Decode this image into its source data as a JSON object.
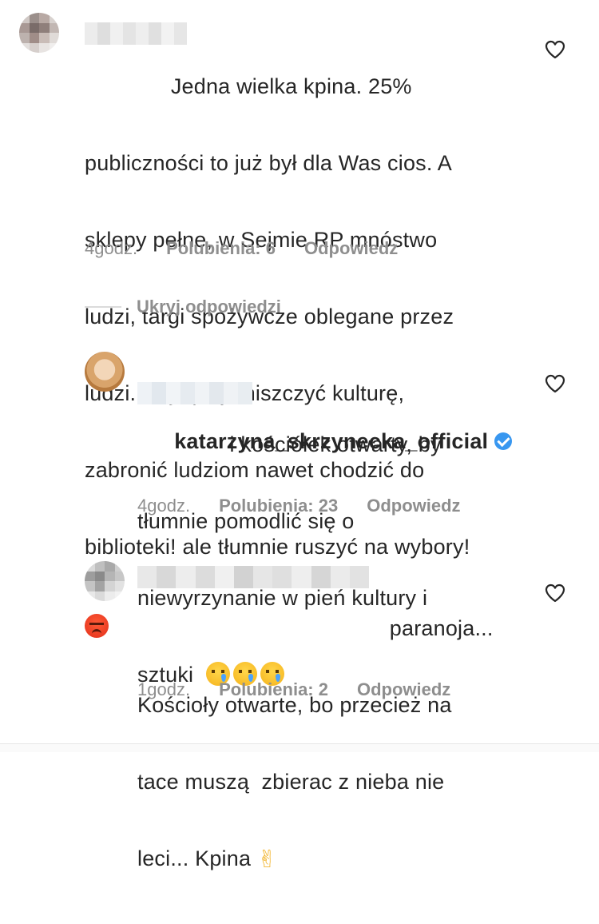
{
  "comments": [
    {
      "text_lines": [
        "              Jedna wielka kpina. 25%",
        "publiczności to już był dla Was cios. A",
        "sklepy pełne, w Sejmie RP mnóstwo",
        "ludzi, targi spożywcze oblegane przez",
        "ludzi. Najlepiej zniszczyć kulturę,",
        "zabronić ludziom nawet chodzić do",
        "biblioteki! ale tłumnie ruszyć na wybory!"
      ],
      "emoji": "angry-face-emoji",
      "time": "4godz.",
      "likes": "Polubienia: 6",
      "reply": "Odpowiedz"
    }
  ],
  "hide_replies": "Ukryj odpowiedzi",
  "replies": [
    {
      "username": "katarzyna_skrzynecka_official",
      "verified": true,
      "text_lines": [
        "               i kościółek otwarty, by",
        "tłumnie pomodlić się o",
        "niewyrzynanie w pień kultury i",
        "sztuki"
      ],
      "emoji": "crying-face-emoji",
      "time": "4godz.",
      "likes": "Polubienia: 23",
      "reply": "Odpowiedz"
    },
    {
      "text_lines": [
        "                                         paranoja...",
        "Kościoły otwarte, bo przecież na",
        "tace muszą  zbierac z nieba nie",
        "leci... Kpina"
      ],
      "emoji": "victory-hand-emoji",
      "time": "1godz.",
      "likes": "Polubienia: 2",
      "reply": "Odpowiedz"
    }
  ],
  "colors": {
    "text": "#262626",
    "meta": "#8e8e8e",
    "verified": "#3897f0"
  }
}
